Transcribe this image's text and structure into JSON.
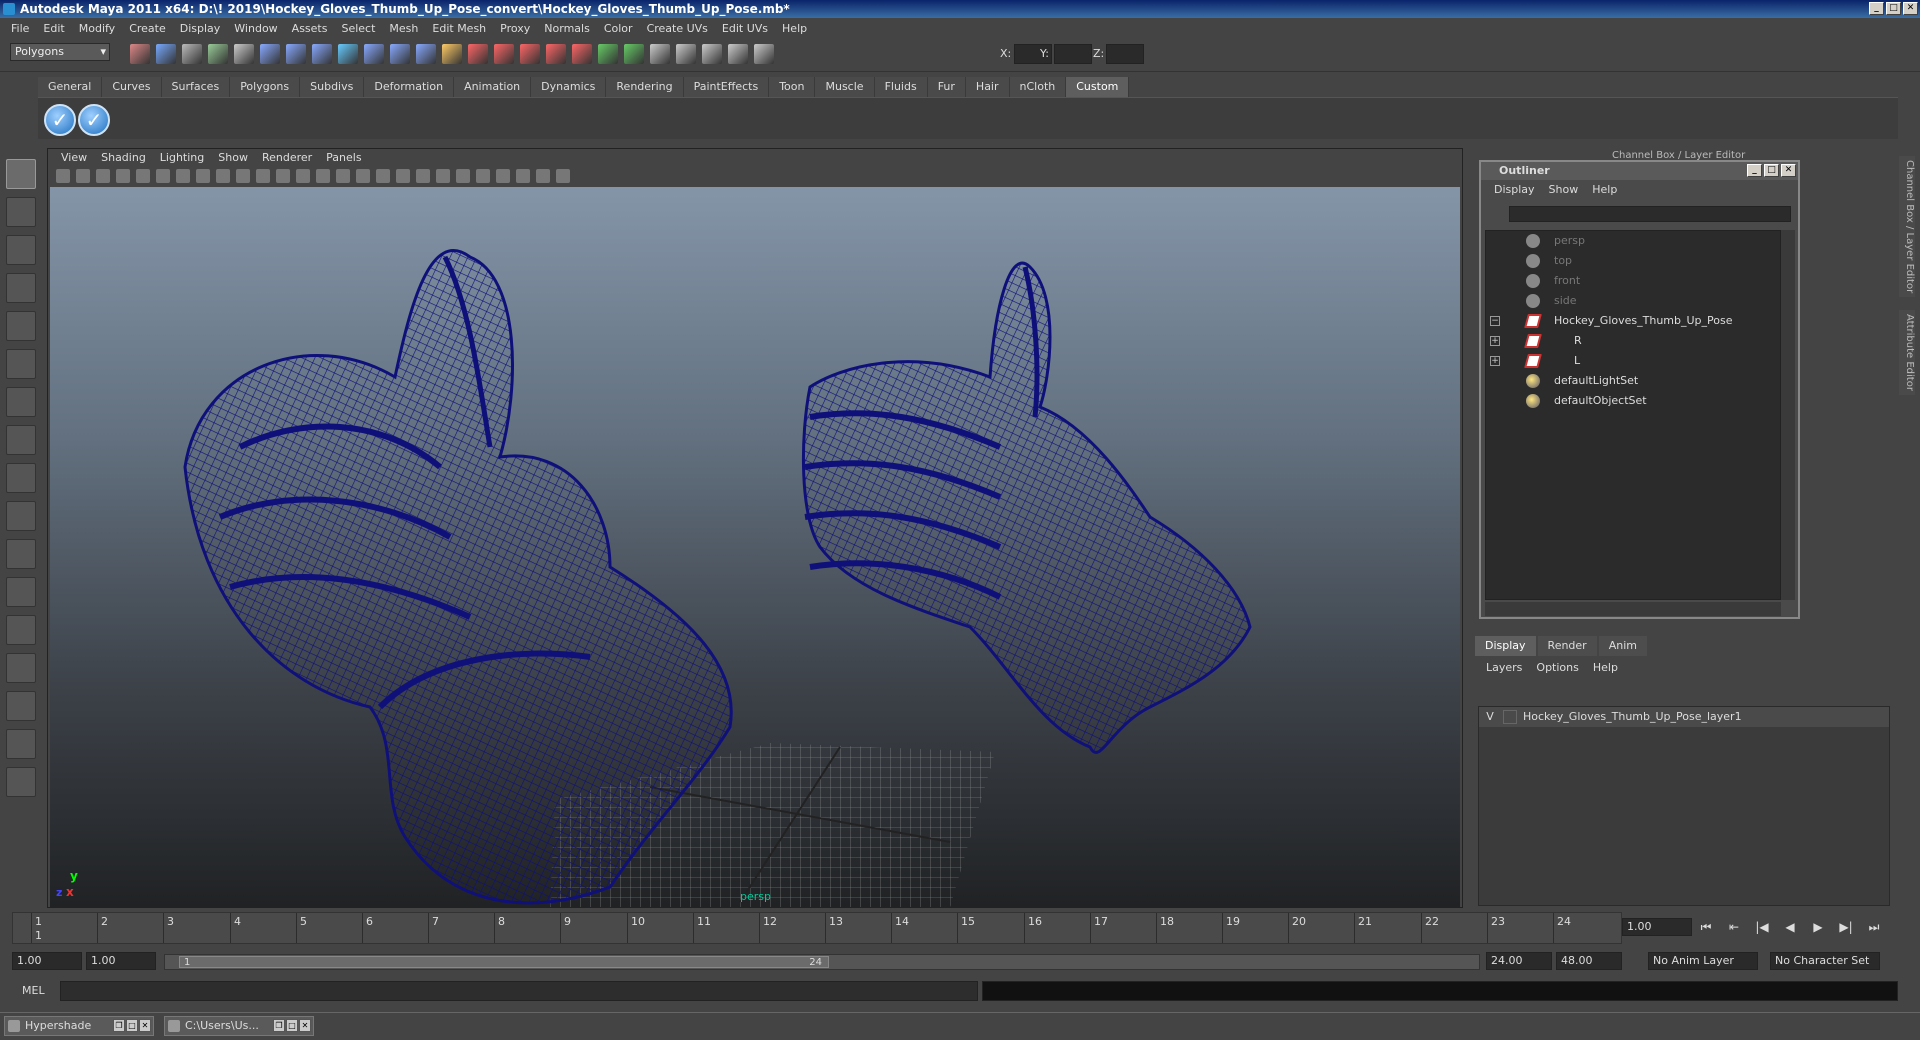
{
  "window": {
    "title": "Autodesk Maya 2011 x64: D:\\! 2019\\Hockey_Gloves_Thumb_Up_Pose_convert\\Hockey_Gloves_Thumb_Up_Pose.mb*"
  },
  "menubar": [
    "File",
    "Edit",
    "Modify",
    "Create",
    "Display",
    "Window",
    "Assets",
    "Select",
    "Mesh",
    "Edit Mesh",
    "Proxy",
    "Normals",
    "Color",
    "Create UVs",
    "Edit UVs",
    "Help"
  ],
  "statusline": {
    "mode": "Polygons",
    "x_label": "X:",
    "y_label": "Y:",
    "z_label": "Z:"
  },
  "shelf": {
    "tabs": [
      "General",
      "Curves",
      "Surfaces",
      "Polygons",
      "Subdivs",
      "Deformation",
      "Animation",
      "Dynamics",
      "Rendering",
      "PaintEffects",
      "Toon",
      "Muscle",
      "Fluids",
      "Fur",
      "Hair",
      "nCloth",
      "Custom"
    ],
    "active": "Custom"
  },
  "viewport": {
    "menu": [
      "View",
      "Shading",
      "Lighting",
      "Show",
      "Renderer",
      "Panels"
    ],
    "camera_label": "persp",
    "axis_y": "y",
    "axis_x": "x",
    "axis_z": "z"
  },
  "outliner": {
    "title": "Outliner",
    "menu": [
      "Display",
      "Show",
      "Help"
    ],
    "items": [
      {
        "label": "persp",
        "type": "camera",
        "dim": true
      },
      {
        "label": "top",
        "type": "camera",
        "dim": true
      },
      {
        "label": "front",
        "type": "camera",
        "dim": true
      },
      {
        "label": "side",
        "type": "camera",
        "dim": true
      },
      {
        "label": "Hockey_Gloves_Thumb_Up_Pose",
        "type": "mesh",
        "expander": "−"
      },
      {
        "label": "R",
        "type": "mesh",
        "expander": "+"
      },
      {
        "label": "L",
        "type": "mesh",
        "expander": "+"
      },
      {
        "label": "defaultLightSet",
        "type": "set"
      },
      {
        "label": "defaultObjectSet",
        "type": "set"
      }
    ]
  },
  "channelbox": {
    "title": "Channel Box / Layer Editor",
    "sidetabs": [
      "Channel Box / Layer Editor",
      "Attribute Editor"
    ]
  },
  "layers": {
    "tabs": [
      "Display",
      "Render",
      "Anim"
    ],
    "active": "Display",
    "menu": [
      "Layers",
      "Options",
      "Help"
    ],
    "items": [
      {
        "visible": "V",
        "name": "Hockey_Gloves_Thumb_Up_Pose_layer1"
      }
    ]
  },
  "timeline": {
    "ticks": [
      "1",
      "2",
      "3",
      "4",
      "5",
      "6",
      "7",
      "8",
      "9",
      "10",
      "11",
      "12",
      "13",
      "14",
      "15",
      "16",
      "17",
      "18",
      "19",
      "20",
      "21",
      "22",
      "23",
      "24"
    ],
    "current_frame_marker": "1",
    "current_frame": "1.00"
  },
  "range": {
    "start": "1.00",
    "playback_start": "1.00",
    "slider_start": "1",
    "slider_end": "24",
    "playback_end": "24.00",
    "end": "48.00",
    "anim_layer": "No Anim Layer",
    "character_set": "No Character Set"
  },
  "cmdline": {
    "label": "MEL"
  },
  "taskbar": [
    {
      "label": "Hypershade"
    },
    {
      "label": "C:\\Users\\Us..."
    }
  ],
  "colors": {
    "wireframe": "#10107a",
    "accent": "#1d6fc0"
  }
}
